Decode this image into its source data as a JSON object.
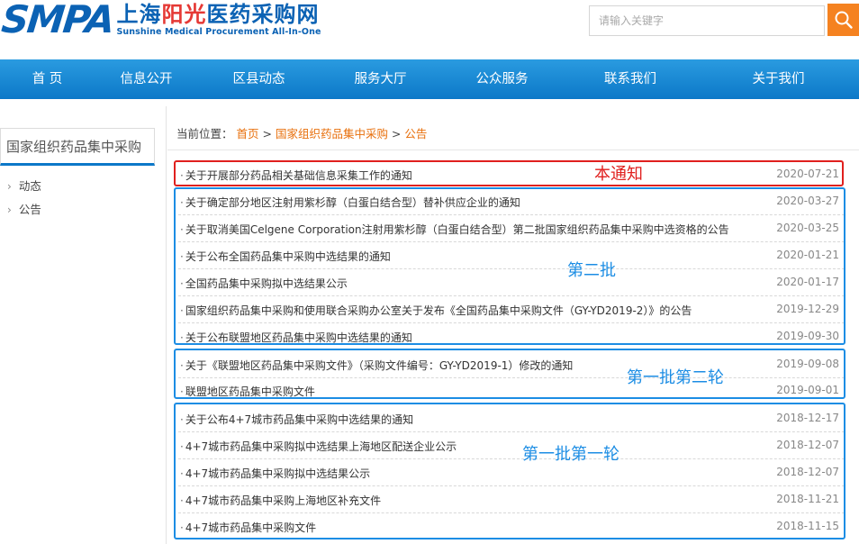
{
  "logo": {
    "smpa": "SMPA",
    "cn_prefix": "上海",
    "cn_highlight": "阳光",
    "cn_suffix": "医药采购网",
    "en": "Sunshine Medical Procurement All-In-One"
  },
  "search": {
    "placeholder": "请输入关键字",
    "icon": "search-icon"
  },
  "nav": {
    "items": [
      {
        "label": "首 页"
      },
      {
        "label": "信息公开"
      },
      {
        "label": "区县动态"
      },
      {
        "label": "服务大厅"
      },
      {
        "label": "公众服务"
      },
      {
        "label": "联系我们"
      },
      {
        "label": "关于我们"
      }
    ]
  },
  "sidebar": {
    "title": "国家组织药品集中采购",
    "items": [
      {
        "label": "动态"
      },
      {
        "label": "公告"
      }
    ]
  },
  "breadcrumb": {
    "prefix": "当前位置：",
    "home": "首页",
    "sep1": " > ",
    "category": "国家组织药品集中采购",
    "sep2": " > ",
    "current": "公告"
  },
  "notices": [
    {
      "title": "关于开展部分药品相关基础信息采集工作的通知",
      "date": "2020-07-21"
    },
    {
      "title": "关于确定部分地区注射用紫杉醇（白蛋白结合型）替补供应企业的通知",
      "date": "2020-03-27"
    },
    {
      "title": "关于取消美国Celgene Corporation注射用紫杉醇（白蛋白结合型）第二批国家组织药品集中采购中选资格的公告",
      "date": "2020-03-25"
    },
    {
      "title": "关于公布全国药品集中采购中选结果的通知",
      "date": "2020-01-21"
    },
    {
      "title": "全国药品集中采购拟中选结果公示",
      "date": "2020-01-17"
    },
    {
      "title": "国家组织药品集中采购和使用联合采购办公室关于发布《全国药品集中采购文件（GY-YD2019-2）》的公告",
      "date": "2019-12-29"
    },
    {
      "title": "关于公布联盟地区药品集中采购中选结果的通知",
      "date": "2019-09-30"
    },
    {
      "title": "关于《联盟地区药品集中采购文件》（采购文件编号：GY-YD2019-1）修改的通知",
      "date": "2019-09-08"
    },
    {
      "title": "联盟地区药品集中采购文件",
      "date": "2019-09-01"
    },
    {
      "title": "关于公布4+7城市药品集中采购中选结果的通知",
      "date": "2018-12-17"
    },
    {
      "title": "4+7城市药品集中采购拟中选结果上海地区配送企业公示",
      "date": "2018-12-07"
    },
    {
      "title": "4+7城市药品集中采购拟中选结果公示",
      "date": "2018-12-07"
    },
    {
      "title": "4+7城市药品集中采购上海地区补充文件",
      "date": "2018-11-21"
    },
    {
      "title": "4+7城市药品集中采购文件",
      "date": "2018-11-15"
    }
  ],
  "annotations": {
    "this_notice": "本通知",
    "batch2": "第二批",
    "batch1_round2": "第一批第二轮",
    "batch1_round1": "第一批第一轮"
  },
  "colors": {
    "brand_blue": "#0b62b4",
    "nav_blue": "#0c78c8",
    "search_orange": "#f58220",
    "link_orange": "#e8700d",
    "annotation_red": "#e0201e",
    "annotation_blue": "#1c8de4"
  }
}
